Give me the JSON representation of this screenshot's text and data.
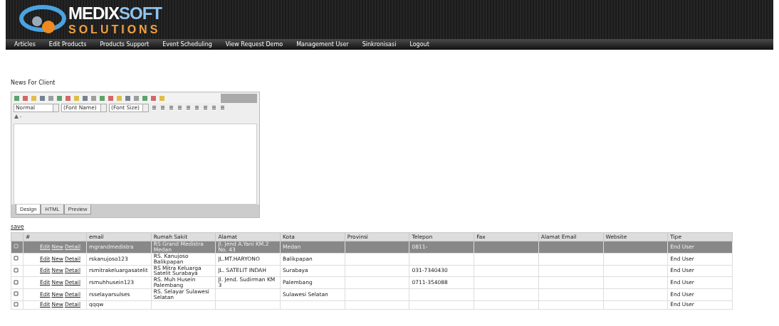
{
  "logo": {
    "line1": "MEDIX",
    "line1b": "SOFT",
    "line2": "SOLUTIONS"
  },
  "nav": [
    "Articles",
    "Edit Products",
    "Products Support",
    "Event Scheduling",
    "View Request Demo",
    "Management User",
    "Sinkronisasi",
    "Logout"
  ],
  "page_label": "News For Client",
  "editor": {
    "format": "Normal",
    "font_name": "(Font Name)",
    "font_size": "(Font Size)",
    "tabs": [
      {
        "label": "Design",
        "selected": true
      },
      {
        "label": "HTML",
        "selected": false
      },
      {
        "label": "Preview",
        "selected": false
      }
    ]
  },
  "save_link": "save",
  "table": {
    "link_column": "#",
    "columns": [
      "email",
      "Rumah Sakit",
      "Alamat",
      "Kota",
      "Provinsi",
      "Telepon",
      "Fax",
      "Alamat Email",
      "Website",
      "Tipe"
    ],
    "rows": [
      {
        "selected": true,
        "links": [
          "Edit",
          "New",
          "Detail"
        ],
        "cells": [
          "mgrandmedistra",
          "RS Grand Medistra Medan",
          "Jl. Jend A.Yani KM.2 No. 43",
          "Medan",
          "",
          "0811-",
          "",
          "",
          "",
          "End User"
        ]
      },
      {
        "selected": false,
        "links": [
          "Edit",
          "New",
          "Detail"
        ],
        "cells": [
          "rskanujoso123",
          "RS. Kanujoso Balikpapan",
          "JL.MT.HARYONO",
          "Balikpapan",
          "",
          "",
          "",
          "",
          "",
          "End User"
        ]
      },
      {
        "selected": false,
        "links": [
          "Edit",
          "New",
          "Detail"
        ],
        "cells": [
          "rsmitrakeluargasatelit",
          "RS Mitra Keluarga Satelit Surabaya",
          "JL. SATELIT INDAH",
          "Surabaya",
          "",
          "031-7340430",
          "",
          "",
          "",
          "End User"
        ]
      },
      {
        "selected": false,
        "links": [
          "Edit",
          "New",
          "Detail"
        ],
        "cells": [
          "rsmuhhusein123",
          "RS. Muh Husein Palembang",
          "Jl. Jend. Sudirman KM 3",
          "Palembang",
          "",
          "0711-354088",
          "",
          "",
          "",
          "End User"
        ]
      },
      {
        "selected": false,
        "links": [
          "Edit",
          "New",
          "Detail"
        ],
        "cells": [
          "rsselayarsulses",
          "RS. Selayar Sulawesi Selatan",
          "",
          "Sulawesi Selatan",
          "",
          "",
          "",
          "",
          "",
          "End User"
        ]
      },
      {
        "selected": false,
        "links": [
          "Edit",
          "New",
          "Detail"
        ],
        "cells": [
          "qqqw",
          "",
          "",
          "",
          "",
          "",
          "",
          "",
          "",
          "End User"
        ]
      }
    ]
  }
}
